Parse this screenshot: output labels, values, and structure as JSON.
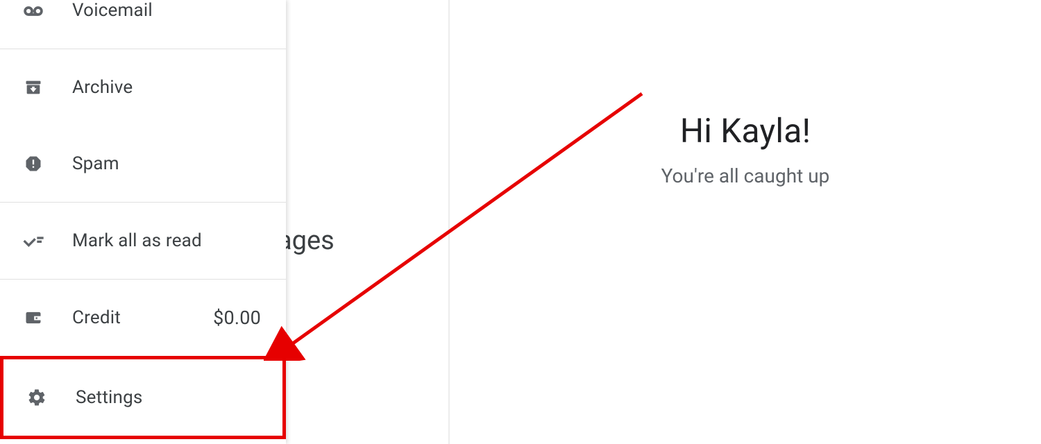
{
  "sidebar": {
    "items": [
      {
        "label": "Voicemail"
      },
      {
        "label": "Archive"
      },
      {
        "label": "Spam"
      },
      {
        "label": "Mark all as read"
      },
      {
        "label": "Credit",
        "value": "$0.00"
      },
      {
        "label": "Settings"
      }
    ]
  },
  "partial_behind": "ages",
  "main": {
    "greeting": "Hi Kayla!",
    "subtext": "You're all caught up"
  }
}
